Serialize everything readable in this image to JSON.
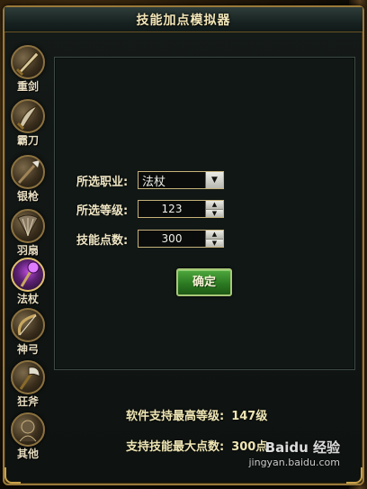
{
  "window": {
    "title": "技能加点模拟器"
  },
  "sidebar": {
    "items": [
      {
        "label": "重剑",
        "icon": "heavy-sword-icon"
      },
      {
        "label": "霸刀",
        "icon": "blade-icon"
      },
      {
        "label": "银枪",
        "icon": "spear-icon"
      },
      {
        "label": "羽扇",
        "icon": "feather-fan-icon"
      },
      {
        "label": "法杖",
        "icon": "magic-staff-icon",
        "active": true
      },
      {
        "label": "神弓",
        "icon": "bow-icon"
      },
      {
        "label": "狂斧",
        "icon": "axe-icon"
      },
      {
        "label": "其他",
        "icon": "other-icon"
      }
    ]
  },
  "form": {
    "class_label": "所选职业:",
    "class_value": "法杖",
    "level_label": "所选等级:",
    "level_value": "123",
    "points_label": "技能点数:",
    "points_value": "300",
    "confirm_label": "确定"
  },
  "info": {
    "max_level_label": "软件支持最高等级:",
    "max_level_value": "147级",
    "max_points_label": "支持技能最大点数:",
    "max_points_value": "300点"
  },
  "watermark": {
    "brand": "Baidu 经验",
    "url": "jingyan.baidu.com"
  },
  "colors": {
    "accent_gold": "#c6b27a",
    "confirm_green": "#2c7a22",
    "active_purple": "#b84ad8"
  }
}
